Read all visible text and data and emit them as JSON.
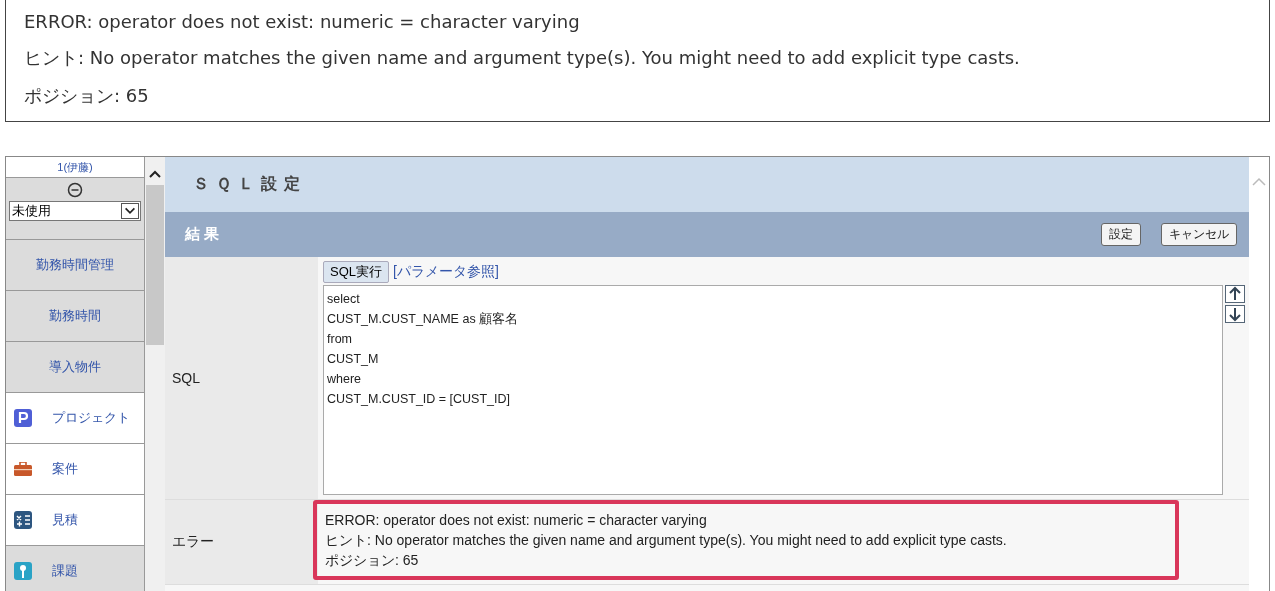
{
  "error_message": {
    "lines": [
      "ERROR: operator does not exist: numeric = character varying",
      "ヒント: No operator matches the given name and argument type(s). You might need to add explicit type casts.",
      "ポジション: 65"
    ]
  },
  "sidebar": {
    "user": "1(伊藤)",
    "status_select": {
      "value": "未使用"
    },
    "items": [
      {
        "label": "勤務時間管理",
        "shaded": true,
        "kind": "plain"
      },
      {
        "label": "勤務時間",
        "shaded": true,
        "kind": "plain"
      },
      {
        "label": "導入物件",
        "shaded": true,
        "kind": "plain"
      },
      {
        "label": "プロジェクト",
        "shaded": false,
        "kind": "project"
      },
      {
        "label": "案件",
        "shaded": false,
        "kind": "deal"
      },
      {
        "label": "見積",
        "shaded": false,
        "kind": "estimate"
      },
      {
        "label": "課題",
        "shaded": true,
        "kind": "issue"
      }
    ]
  },
  "page": {
    "title": "ＳＱＬ設定",
    "section": "結果",
    "buttons": [
      "設定",
      "キャンセル"
    ],
    "sql_row": {
      "label": "SQL",
      "run_button": "SQL実行",
      "link": "[パラメータ参照]",
      "code": [
        "select",
        "CUST_M.CUST_NAME as 顧客名",
        "from",
        "CUST_M",
        "where",
        "CUST_M.CUST_ID = [CUST_ID]"
      ]
    },
    "error_row": {
      "label": "エラー",
      "lines": [
        "ERROR: operator does not exist: numeric = character varying",
        "ヒント: No operator matches the given name and argument type(s). You might need to add explicit type casts.",
        "ポジション: 65"
      ],
      "highlighted": true
    }
  }
}
